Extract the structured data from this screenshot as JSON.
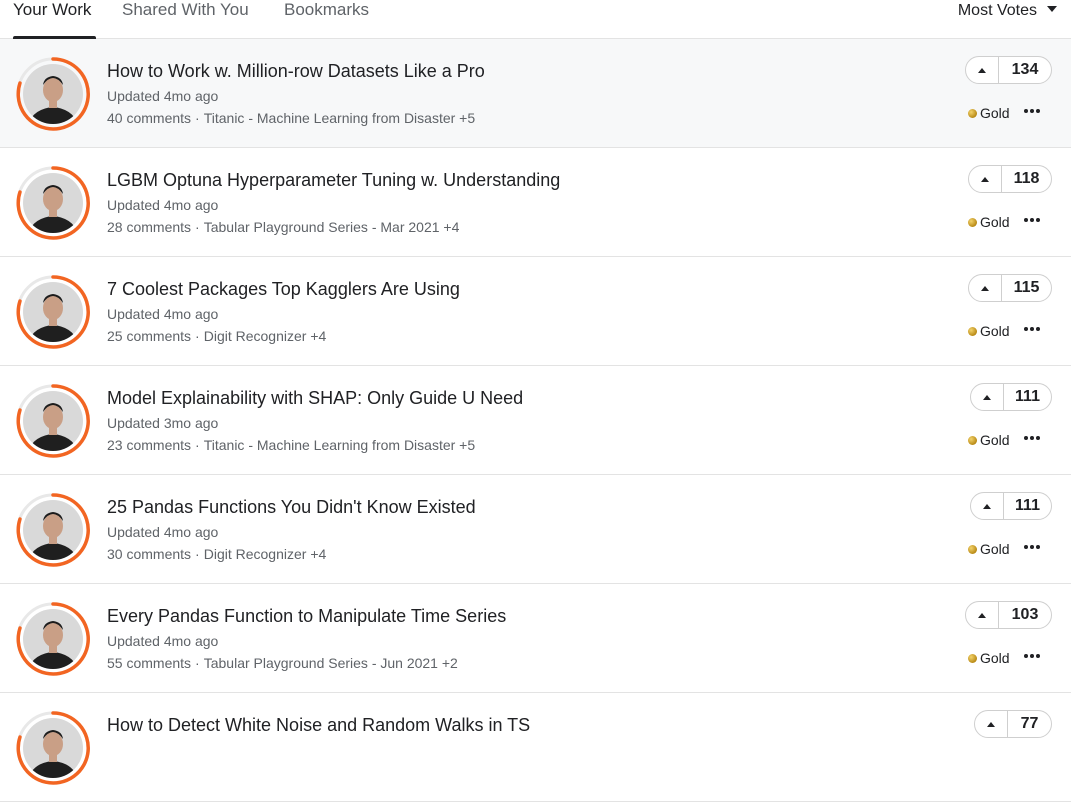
{
  "tabs": [
    {
      "label": "Your Work"
    },
    {
      "label": "Shared With You"
    },
    {
      "label": "Bookmarks"
    }
  ],
  "sort": {
    "label": "Most Votes"
  },
  "colors": {
    "ring": "#f26522",
    "gold": "#c9a227"
  },
  "items": [
    {
      "title": "How to Work w. Million-row Datasets Like a Pro",
      "updated": "Updated 4mo ago",
      "comments": "40 comments",
      "tags": "Titanic - Machine Learning from Disaster +5",
      "votes": "134",
      "medal": "Gold"
    },
    {
      "title": "LGBM Optuna Hyperparameter Tuning w. Understanding",
      "updated": "Updated 4mo ago",
      "comments": "28 comments",
      "tags": "Tabular Playground Series - Mar 2021 +4",
      "votes": "118",
      "medal": "Gold"
    },
    {
      "title": "7 Coolest Packages Top Kagglers Are Using",
      "updated": "Updated 4mo ago",
      "comments": "25 comments",
      "tags": "Digit Recognizer +4",
      "votes": "115",
      "medal": "Gold"
    },
    {
      "title": "Model Explainability with SHAP: Only Guide U Need",
      "updated": "Updated 3mo ago",
      "comments": "23 comments",
      "tags": "Titanic - Machine Learning from Disaster +5",
      "votes": "111",
      "medal": "Gold"
    },
    {
      "title": "25 Pandas Functions You Didn't Know Existed",
      "updated": "Updated 4mo ago",
      "comments": "30 comments",
      "tags": "Digit Recognizer +4",
      "votes": "111",
      "medal": "Gold"
    },
    {
      "title": "Every Pandas Function to Manipulate Time Series",
      "updated": "Updated 4mo ago",
      "comments": "55 comments",
      "tags": "Tabular Playground Series - Jun 2021 +2",
      "votes": "103",
      "medal": "Gold"
    },
    {
      "title": "How to Detect White Noise and Random Walks in TS",
      "votes": "77"
    }
  ]
}
